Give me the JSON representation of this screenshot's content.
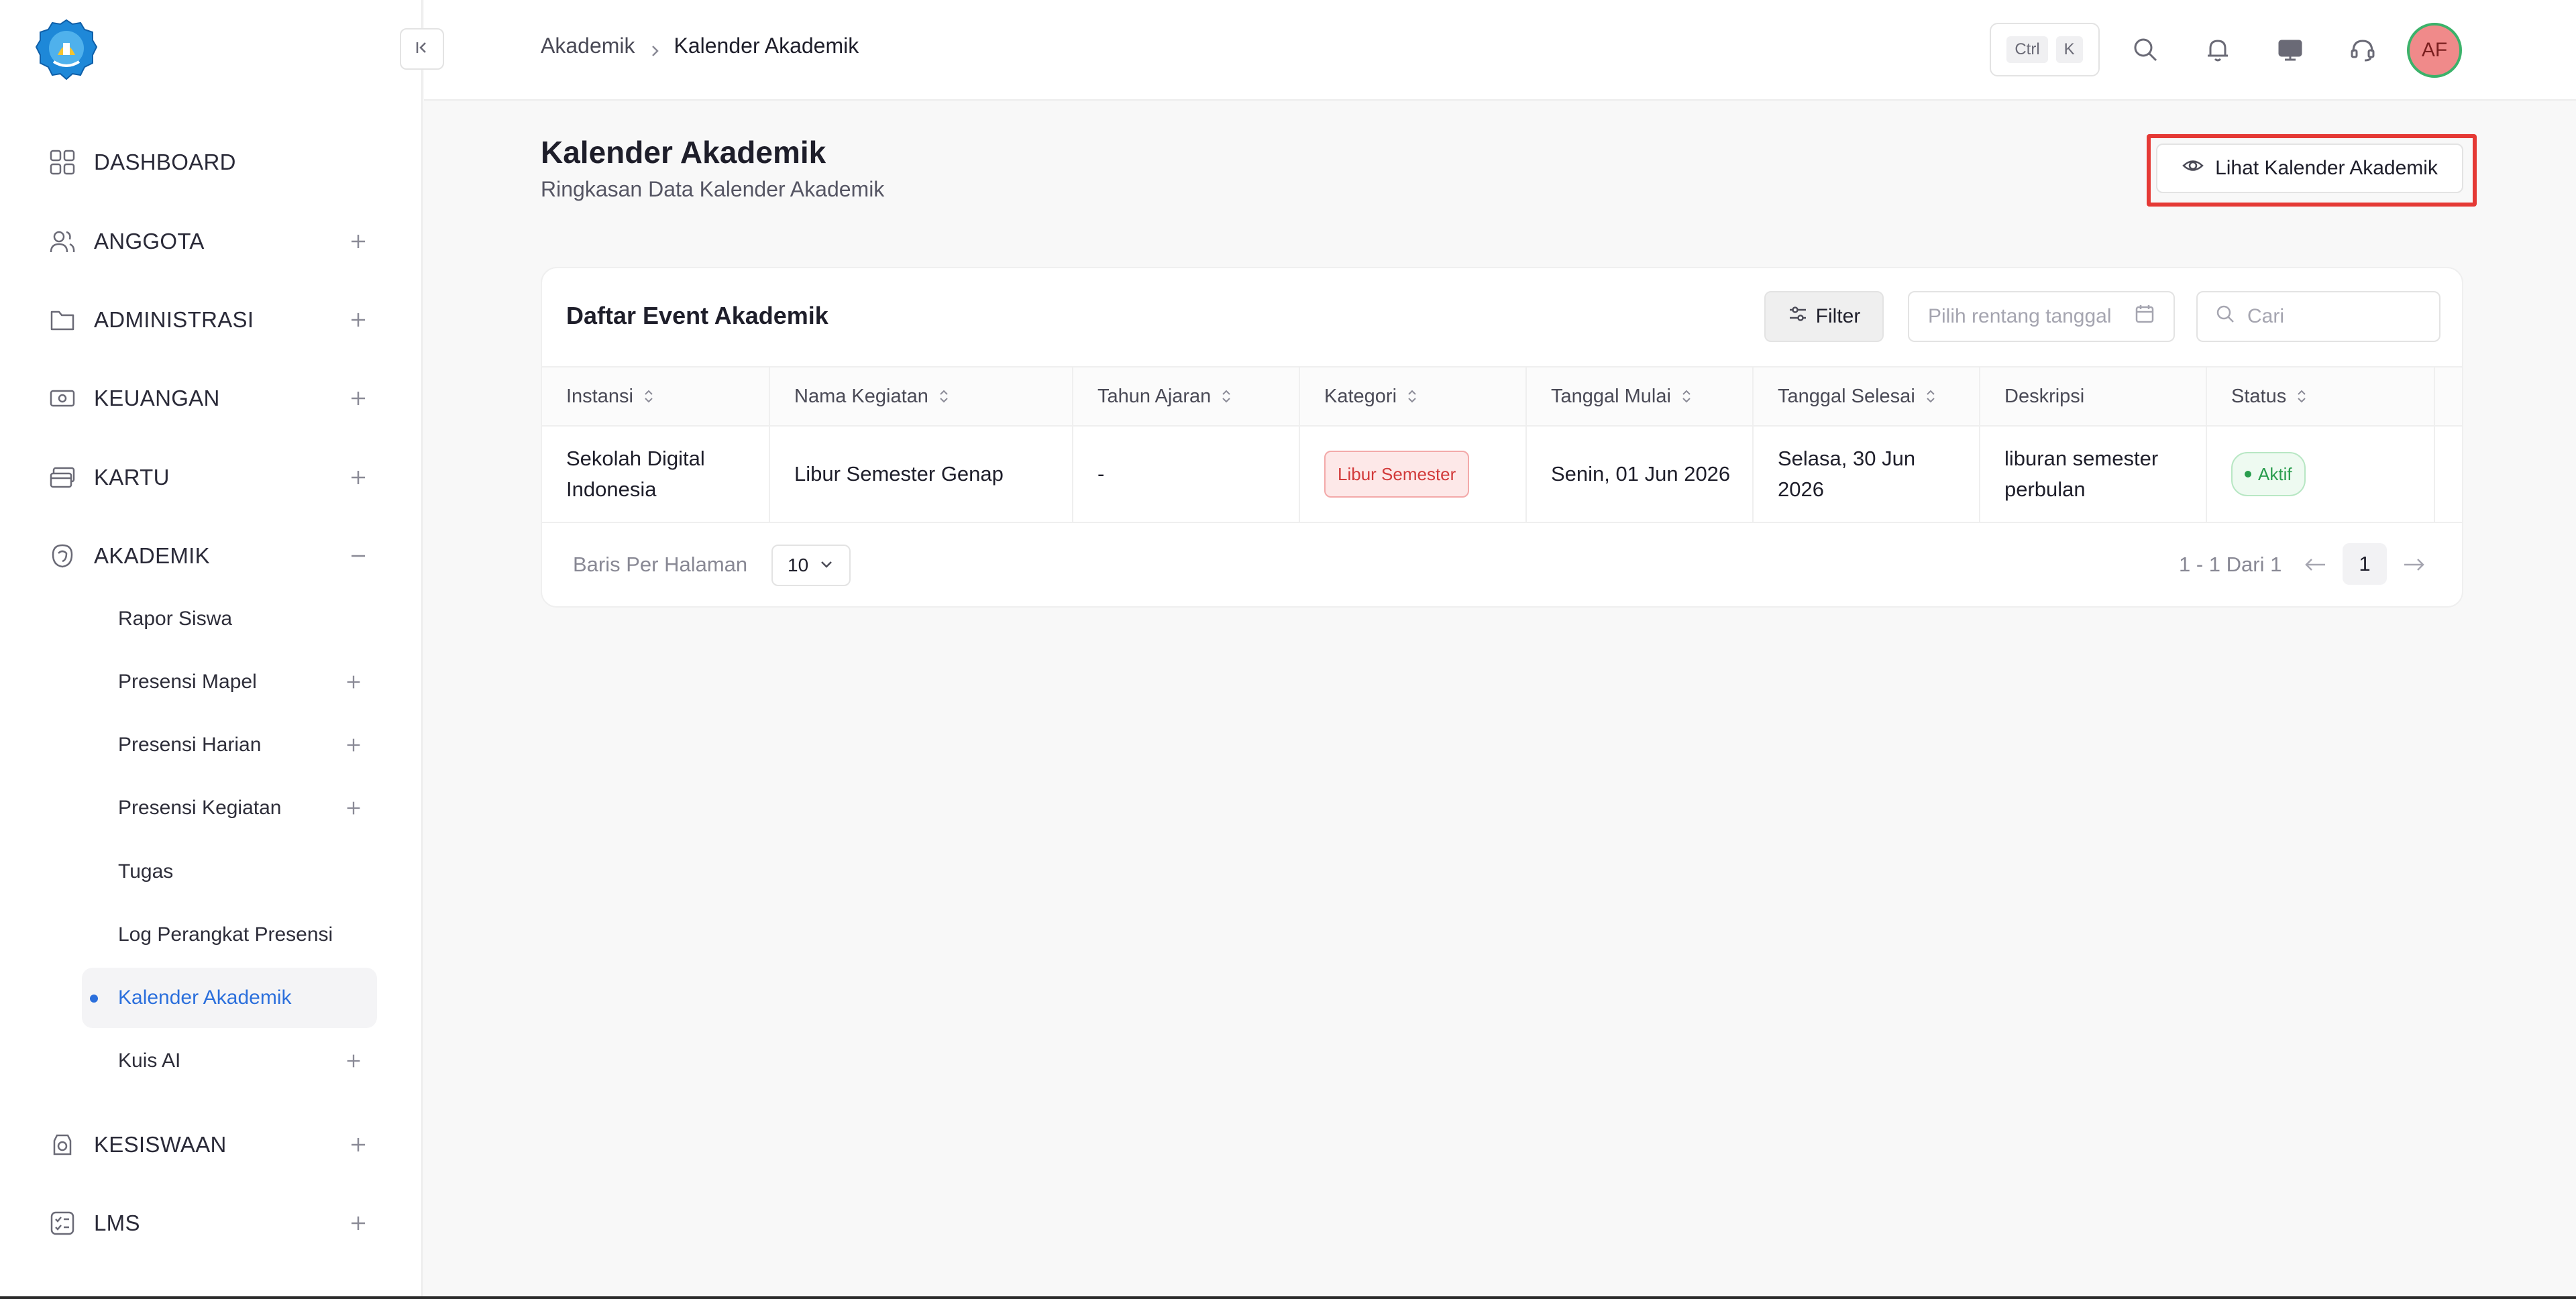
{
  "sidebar": {
    "items": [
      {
        "label": "DASHBOARD"
      },
      {
        "label": "ANGGOTA"
      },
      {
        "label": "ADMINISTRASI"
      },
      {
        "label": "KEUANGAN"
      },
      {
        "label": "KARTU"
      },
      {
        "label": "AKADEMIK"
      },
      {
        "label": "KESISWAAN"
      },
      {
        "label": "LMS"
      }
    ],
    "akademik_sub": [
      {
        "label": "Rapor Siswa"
      },
      {
        "label": "Presensi Mapel"
      },
      {
        "label": "Presensi Harian"
      },
      {
        "label": "Presensi Kegiatan"
      },
      {
        "label": "Tugas"
      },
      {
        "label": "Log Perangkat Presensi"
      },
      {
        "label": "Kalender Akademik",
        "active": true
      },
      {
        "label": "Kuis AI"
      }
    ]
  },
  "header": {
    "breadcrumb": [
      "Akademik",
      "Kalender Akademik"
    ],
    "shortcut_keys": [
      "Ctrl",
      "K"
    ],
    "avatar_initials": "AF"
  },
  "page": {
    "title": "Kalender Akademik",
    "subtitle": "Ringkasan Data Kalender Akademik",
    "view_button": "Lihat Kalender Akademik"
  },
  "table_card": {
    "title": "Daftar Event Akademik",
    "filter_label": "Filter",
    "date_placeholder": "Pilih rentang tanggal",
    "search_placeholder": "Cari",
    "columns": [
      "Instansi",
      "Nama Kegiatan",
      "Tahun Ajaran",
      "Kategori",
      "Tanggal Mulai",
      "Tanggal Selesai",
      "Deskripsi",
      "Status"
    ],
    "rows": [
      {
        "instansi": "Sekolah Digital Indonesia",
        "nama_kegiatan": "Libur Semester Genap",
        "tahun_ajaran": "-",
        "kategori": "Libur Semester",
        "tanggal_mulai": "Senin, 01 Jun 2026",
        "tanggal_selesai": "Selasa, 30 Jun 2026",
        "deskripsi": "liburan semester perbulan",
        "status": "Aktif"
      }
    ],
    "rows_per_page_label": "Baris Per Halaman",
    "rows_per_page_value": "10",
    "pagination_text": "1 - 1 Dari 1",
    "current_page": "1"
  },
  "colors": {
    "accent": "#2b6fdc",
    "highlight_border": "#e53935",
    "badge_red": "#d23a3a",
    "badge_green": "#2a9d4e"
  }
}
